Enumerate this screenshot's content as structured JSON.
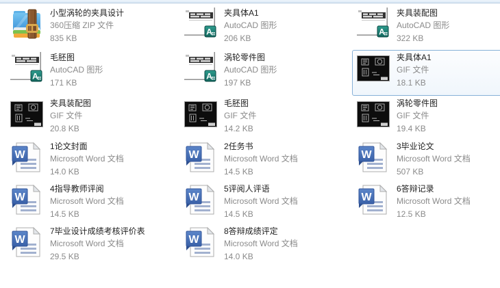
{
  "colors": {
    "selection_border": "#86b0d7",
    "selection_fill": "#f0f6fc",
    "toolbar_band": "#dbe9f6",
    "filename_text": "#1f1f1f",
    "secondary_text": "#8a8a8a",
    "word_badge_blue": "#4a72bc",
    "autocad_badge_teal": "#1d7a72",
    "zip_folder_blue": "#4da4e0",
    "gif_thumbnail_black": "#0d0d0d"
  },
  "files": [
    {
      "name": "小型涡轮的夹具设计",
      "type": "360压缩 ZIP 文件",
      "size": "835 KB",
      "icon": "zip",
      "selected": false
    },
    {
      "name": "夹具体A1",
      "type": "AutoCAD 图形",
      "size": "206 KB",
      "icon": "dwg",
      "selected": false
    },
    {
      "name": "夹具装配图",
      "type": "AutoCAD 图形",
      "size": "322 KB",
      "icon": "dwg",
      "selected": false
    },
    {
      "name": "毛胚图",
      "type": "AutoCAD 图形",
      "size": "171 KB",
      "icon": "dwg",
      "selected": false
    },
    {
      "name": "涡轮零件图",
      "type": "AutoCAD 图形",
      "size": "197 KB",
      "icon": "dwg",
      "selected": false
    },
    {
      "name": "夹具体A1",
      "type": "GIF 文件",
      "size": "18.1 KB",
      "icon": "gif",
      "selected": true
    },
    {
      "name": "夹具装配图",
      "type": "GIF 文件",
      "size": "20.8 KB",
      "icon": "gif",
      "selected": false
    },
    {
      "name": "毛胚图",
      "type": "GIF 文件",
      "size": "14.2 KB",
      "icon": "gif",
      "selected": false
    },
    {
      "name": "涡轮零件图",
      "type": "GIF 文件",
      "size": "19.4 KB",
      "icon": "gif",
      "selected": false
    },
    {
      "name": "1论文封面",
      "type": "Microsoft Word 文档",
      "size": "14.0 KB",
      "icon": "word",
      "selected": false
    },
    {
      "name": "2任务书",
      "type": "Microsoft Word 文档",
      "size": "14.5 KB",
      "icon": "word",
      "selected": false
    },
    {
      "name": "3毕业论文",
      "type": "Microsoft Word 文档",
      "size": "507 KB",
      "icon": "word",
      "selected": false
    },
    {
      "name": "4指导教师评阅",
      "type": "Microsoft Word 文档",
      "size": "14.5 KB",
      "icon": "word",
      "selected": false
    },
    {
      "name": "5评阅人评语",
      "type": "Microsoft Word 文档",
      "size": "14.5 KB",
      "icon": "word",
      "selected": false
    },
    {
      "name": "6答辩记录",
      "type": "Microsoft Word 文档",
      "size": "12.5 KB",
      "icon": "word",
      "selected": false
    },
    {
      "name": "7毕业设计成绩考核评价表",
      "type": "Microsoft Word 文档",
      "size": "29.5 KB",
      "icon": "word",
      "selected": false
    },
    {
      "name": "8答辩成绩评定",
      "type": "Microsoft Word 文档",
      "size": "14.0 KB",
      "icon": "word",
      "selected": false
    }
  ]
}
